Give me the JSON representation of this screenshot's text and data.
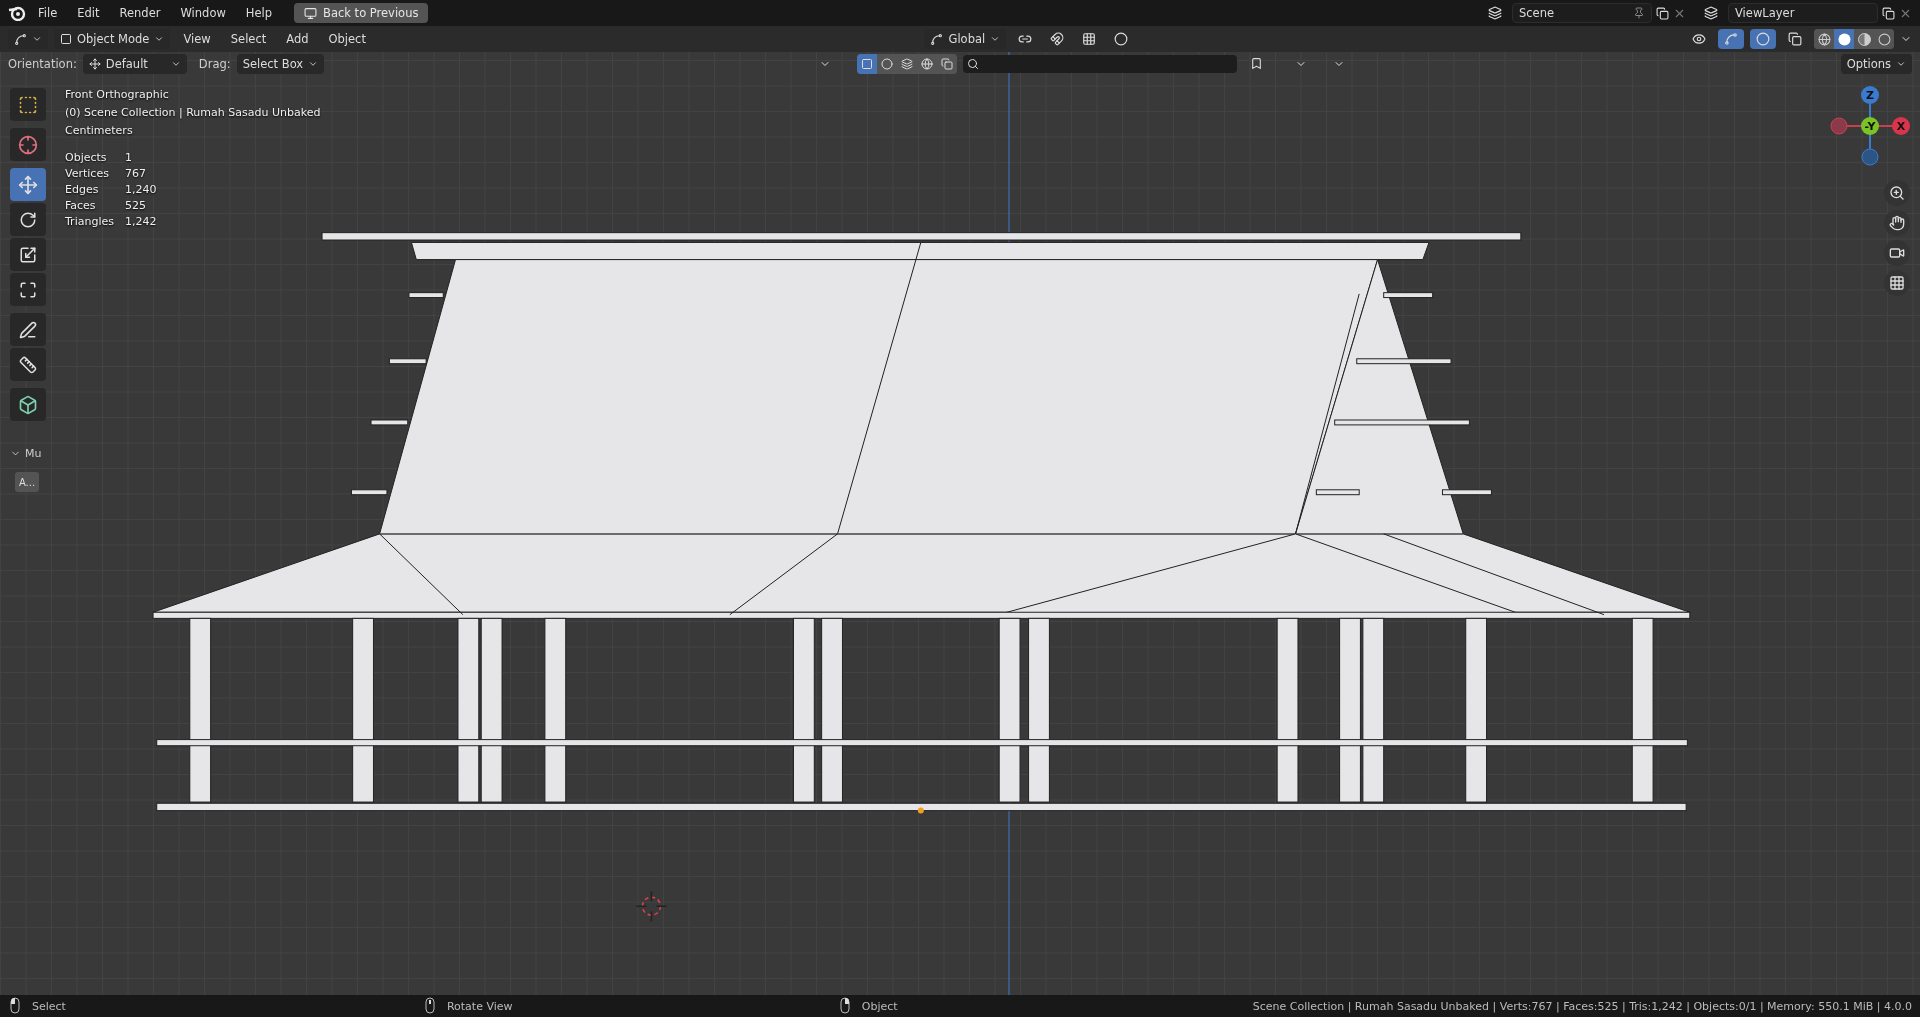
{
  "top_bar": {
    "menus": [
      "File",
      "Edit",
      "Render",
      "Window",
      "Help"
    ],
    "back_button": "Back to Previous",
    "scene": {
      "value": "Scene"
    },
    "view_layer": {
      "value": "ViewLayer"
    }
  },
  "header": {
    "mode": "Object Mode",
    "menus": [
      "View",
      "Select",
      "Add",
      "Object"
    ],
    "orientation": "Global",
    "shading": [
      {
        "kind": "wireframe",
        "selected": false
      },
      {
        "kind": "solid",
        "selected": true
      },
      {
        "kind": "material",
        "selected": false
      },
      {
        "kind": "rendered",
        "selected": false
      }
    ]
  },
  "tool_settings": {
    "orientation_label": "Orientation:",
    "orientation": "Default",
    "drag_label": "Drag:",
    "drag": "Select Box",
    "options": "Options",
    "select_modes": [
      {
        "kind": "set",
        "selected": true
      },
      {
        "kind": "extend",
        "selected": false
      },
      {
        "kind": "subtract",
        "selected": false
      },
      {
        "kind": "invert",
        "selected": false
      },
      {
        "kind": "intersect",
        "selected": false
      }
    ]
  },
  "overlay": {
    "view": "Front Orthographic",
    "collection": "(0) Scene Collection | Rumah Sasadu Unbaked",
    "units": "Centimeters",
    "stats": [
      {
        "label": "Objects",
        "value": "1"
      },
      {
        "label": "Vertices",
        "value": "767"
      },
      {
        "label": "Edges",
        "value": "1,240"
      },
      {
        "label": "Faces",
        "value": "525"
      },
      {
        "label": "Triangles",
        "value": "1,242"
      }
    ]
  },
  "toolbar": {
    "tools": [
      {
        "kind": "select",
        "selected": false
      },
      {
        "kind": "cursor",
        "selected": false
      },
      {
        "kind": "move",
        "selected": true
      },
      {
        "kind": "rotate",
        "selected": false
      },
      {
        "kind": "scale",
        "selected": false
      },
      {
        "kind": "transform",
        "selected": false
      },
      {
        "kind": "annotate",
        "selected": false
      },
      {
        "kind": "measure",
        "selected": false
      },
      {
        "kind": "add",
        "selected": false
      }
    ],
    "panel_label": "Mu",
    "panel_button": "A..."
  },
  "gizmo": {
    "axes": [
      {
        "label": "Z"
      },
      {
        "label": "-Y"
      },
      {
        "label": "X"
      }
    ]
  },
  "status_bar": {
    "hints": [
      {
        "kind": "left",
        "label": "Select"
      },
      {
        "kind": "middle",
        "label": "Rotate View"
      },
      {
        "kind": "right",
        "label": "Object"
      }
    ],
    "info": "Scene Collection | Rumah Sasadu Unbaked | Verts:767 | Faces:525 | Tris:1,242 | Objects:0/1 | Memory: 550.1 MiB | 4.0.0"
  }
}
